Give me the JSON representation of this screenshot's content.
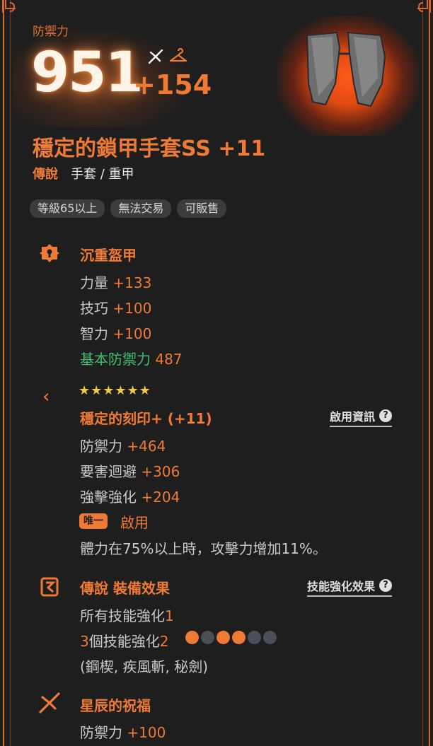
{
  "header": {
    "defense_label": "防禦力",
    "defense_value": "951",
    "defense_bonus": "+154",
    "icons": [
      "star-sparkle-icon",
      "hanger-icon"
    ]
  },
  "item": {
    "name": "穩定的鎖甲手套SS +11",
    "rarity": "傳說",
    "type": "手套 / 重甲",
    "image": "gauntlet-icon",
    "tags": [
      "等級65以上",
      "無法交易",
      "可販售"
    ]
  },
  "heavy_armor": {
    "title": "沉重盔甲",
    "stats": [
      {
        "name": "力量 ",
        "value": "+133"
      },
      {
        "name": "技巧 ",
        "value": "+100"
      },
      {
        "name": "智力 ",
        "value": "+100"
      }
    ],
    "base_defense": {
      "name": "基本防禦力 ",
      "value": "487"
    }
  },
  "engraving": {
    "stars": "★★★★★★",
    "star_count": 6,
    "title": "穩定的刻印+ (+11)",
    "info_link": "啟用資訊",
    "stats": [
      {
        "name": "防禦力 ",
        "value": "+464"
      },
      {
        "name": "要害迴避 ",
        "value": "+306"
      },
      {
        "name": "強擊強化 ",
        "value": "+204"
      }
    ],
    "unique_badge": "唯一",
    "activate_label": "啟用",
    "effect": "體力在75%以上時，攻擊力增加11%。"
  },
  "legend_effect": {
    "title": "傳說  裝備效果",
    "link": "技能強化效果",
    "line1_name": "所有技能強化",
    "line1_value": "1",
    "line2_name": "3個技能強化",
    "line2_prefix": "3",
    "line2_rest": "個技能強化",
    "line2_value": "2",
    "dots": [
      true,
      false,
      true,
      true,
      false,
      false
    ],
    "skills": "(鋼楔, 疾風斬, 秘劍)"
  },
  "star_blessing": {
    "title": "星辰的祝福",
    "stat_name": "防禦力 ",
    "stat_value": "+100"
  },
  "colors": {
    "accent": "#ef7a36",
    "green": "#3fbf6f",
    "star_gold": "#f2c84b",
    "background": "#1e1e1e"
  }
}
